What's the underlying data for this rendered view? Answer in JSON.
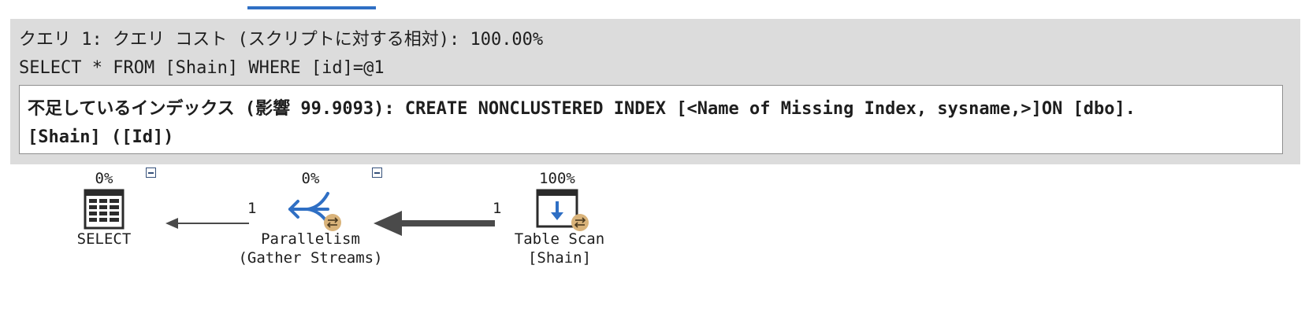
{
  "header": {
    "query_title": "クエリ 1: クエリ コスト (スクリプトに対する相対): 100.00%",
    "query_sql": "SELECT * FROM [Shain] WHERE [id]=@1",
    "missing_index_line1": "不足しているインデックス (影響 99.9093): CREATE NONCLUSTERED INDEX [<Name of Missing Index, sysname,>]ON [dbo].",
    "missing_index_line2": "[Shain] ([Id])"
  },
  "plan": {
    "operators": [
      {
        "name": "SELECT",
        "label_line1": "SELECT",
        "label_line2": "",
        "cost": "0%",
        "icon": "select-result-grid-icon"
      },
      {
        "name": "Parallelism",
        "label_line1": "Parallelism",
        "label_line2": "(Gather Streams)",
        "cost": "0%",
        "icon": "parallelism-gather-streams-icon"
      },
      {
        "name": "Table Scan",
        "label_line1": "Table Scan",
        "label_line2": "[Shain]",
        "cost": "100%",
        "icon": "table-scan-icon"
      }
    ],
    "edges": [
      {
        "from": "Parallelism",
        "to": "SELECT",
        "rows": "1"
      },
      {
        "from": "Table Scan",
        "to": "Parallelism",
        "rows": "1"
      }
    ]
  },
  "colors": {
    "header_background": "#dcdcdc",
    "tab_indicator": "#2f6fc4",
    "parallel_badge": "#d9b37a",
    "icon_blue": "#2f6fc4",
    "arrow": "#4a4a4a"
  }
}
